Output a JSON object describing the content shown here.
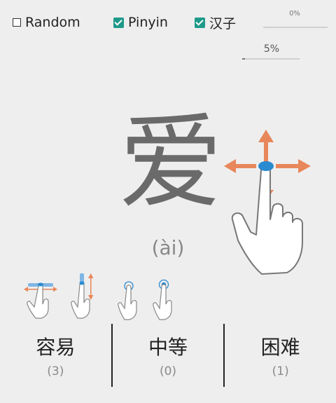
{
  "toolbar": {
    "random_label": "Random",
    "random_checked": false,
    "pinyin_label": "Pinyin",
    "pinyin_checked": true,
    "hanzi_label": "汉子",
    "hanzi_checked": true,
    "progress_top_label": "0%",
    "progress_top_value": 0,
    "progress_second_label": "5%",
    "progress_second_value": 5
  },
  "card": {
    "character": "爱",
    "pinyin": "(ài)"
  },
  "gestures": {
    "main_hint": "hand-drag-four-directions-icon",
    "hints": [
      "swipe-horizontal-icon",
      "swipe-vertical-icon",
      "single-tap-icon",
      "double-tap-icon"
    ]
  },
  "difficulty": [
    {
      "label": "容易",
      "count": "(3)"
    },
    {
      "label": "中等",
      "count": "(0)"
    },
    {
      "label": "困难",
      "count": "(1)"
    }
  ],
  "colors": {
    "checkbox_accent": "#1e9a8a",
    "arrow": "#e8875a",
    "touch": "#2a8bd0"
  }
}
